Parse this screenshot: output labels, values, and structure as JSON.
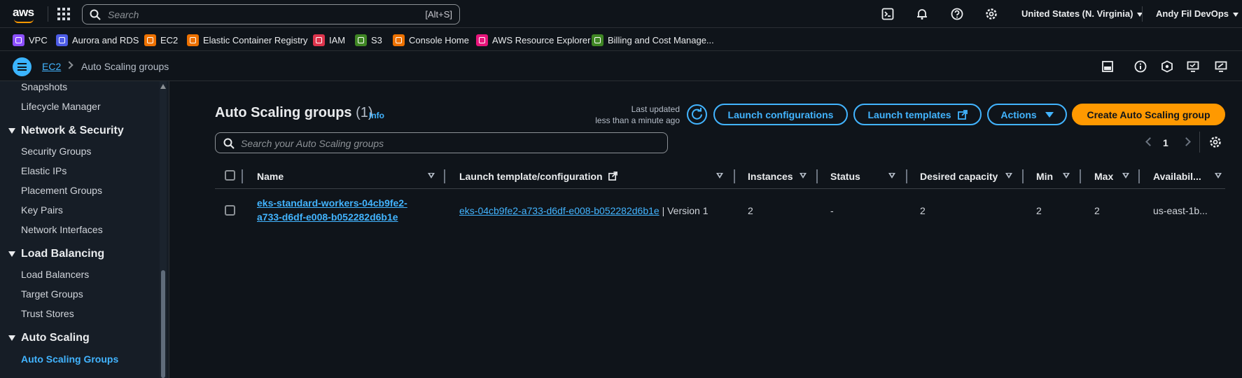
{
  "topnav": {
    "logo_text": "aws",
    "search_placeholder": "Search",
    "search_shortcut": "[Alt+S]",
    "region": "United States (N. Virginia)",
    "user": "Andy Fil DevOps"
  },
  "favorites": [
    {
      "label": "VPC",
      "color": "#8c4fff"
    },
    {
      "label": "Aurora and RDS",
      "color": "#4d5ce6"
    },
    {
      "label": "EC2",
      "color": "#ed7100"
    },
    {
      "label": "Elastic Container Registry",
      "color": "#ed7100"
    },
    {
      "label": "IAM",
      "color": "#dd344c"
    },
    {
      "label": "S3",
      "color": "#3f8624"
    },
    {
      "label": "Console Home",
      "color": "#ed7100"
    },
    {
      "label": "AWS Resource Explorer",
      "color": "#e7157b"
    },
    {
      "label": "Billing and Cost Manage...",
      "color": "#3f8624"
    }
  ],
  "breadcrumb": {
    "parent": "EC2",
    "current": "Auto Scaling groups"
  },
  "sidebar": {
    "items_top": [
      "Snapshots",
      "Lifecycle Manager"
    ],
    "sections": [
      {
        "title": "Network & Security",
        "items": [
          "Security Groups",
          "Elastic IPs",
          "Placement Groups",
          "Key Pairs",
          "Network Interfaces"
        ]
      },
      {
        "title": "Load Balancing",
        "items": [
          "Load Balancers",
          "Target Groups",
          "Trust Stores"
        ]
      },
      {
        "title": "Auto Scaling",
        "items": [
          "Auto Scaling Groups"
        ]
      }
    ]
  },
  "main": {
    "title": "Auto Scaling groups",
    "count": "(1)",
    "info": "Info",
    "last_updated_label": "Last updated",
    "last_updated_value": "less than a minute ago",
    "btn_launch_configs": "Launch configurations",
    "btn_launch_templates": "Launch templates",
    "btn_actions": "Actions",
    "btn_create": "Create Auto Scaling group",
    "filter_placeholder": "Search your Auto Scaling groups",
    "page": "1"
  },
  "table": {
    "columns": [
      "Name",
      "Launch template/configuration",
      "Instances",
      "Status",
      "Desired capacity",
      "Min",
      "Max",
      "Availabil..."
    ],
    "rows": [
      {
        "name": "eks-standard-workers-04cb9fe2-a733-d6df-e008-b052282d6b1e",
        "launch_template": "eks-04cb9fe2-a733-d6df-e008-b052282d6b1e",
        "version": "| Version 1",
        "instances": "2",
        "status": "-",
        "desired": "2",
        "min": "2",
        "max": "2",
        "az": "us-east-1b..."
      }
    ]
  },
  "colors": {
    "accent": "#42b4ff",
    "primary_button": "#ff9900",
    "background": "#0f141a"
  }
}
